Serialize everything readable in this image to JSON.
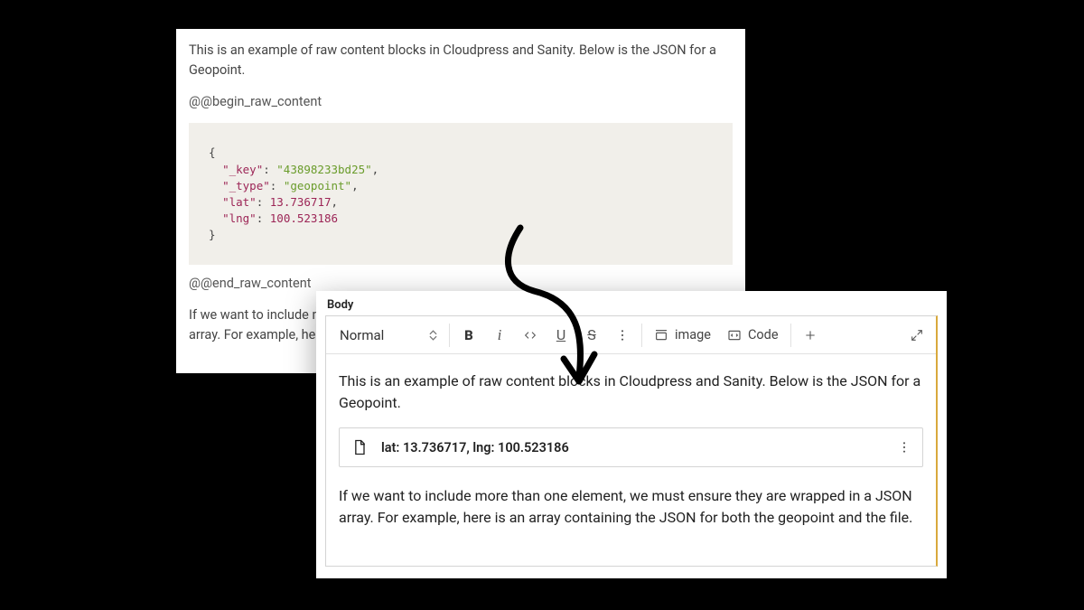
{
  "source": {
    "intro": "This is an example of raw content blocks in Cloudpress and Sanity. Below is the JSON for a Geopoint.",
    "begin_marker": "@@begin_raw_content",
    "end_marker": "@@end_raw_content",
    "json": {
      "_key_k": "\"_key\"",
      "_key_v": "\"43898233bd25\"",
      "_type_k": "\"_type\"",
      "_type_v": "\"geopoint\"",
      "lat_k": "\"lat\"",
      "lat_v": "13.736717",
      "lng_k": "\"lng\"",
      "lng_v": "100.523186"
    },
    "outro": "If we want to include more than one element, we must ensure they are wrapped in a JSON array. For example, here is an array containing the JSON for both the geopoint and the file."
  },
  "editor": {
    "field_label": "Body",
    "style": "Normal",
    "buttons": {
      "bold": "B",
      "italic": "i",
      "underline": "U",
      "strike": "S",
      "image_label": "image",
      "code_label": "Code"
    },
    "para1": "This is an example of raw content blocks in Cloudpress and Sanity. Below is the JSON for a Geopoint.",
    "block_text": "lat: 13.736717, lng: 100.523186",
    "para2": "If we want to include more than one element, we must ensure they are wrapped in a JSON array. For example, here is an array containing the JSON for both the geopoint and the file."
  }
}
